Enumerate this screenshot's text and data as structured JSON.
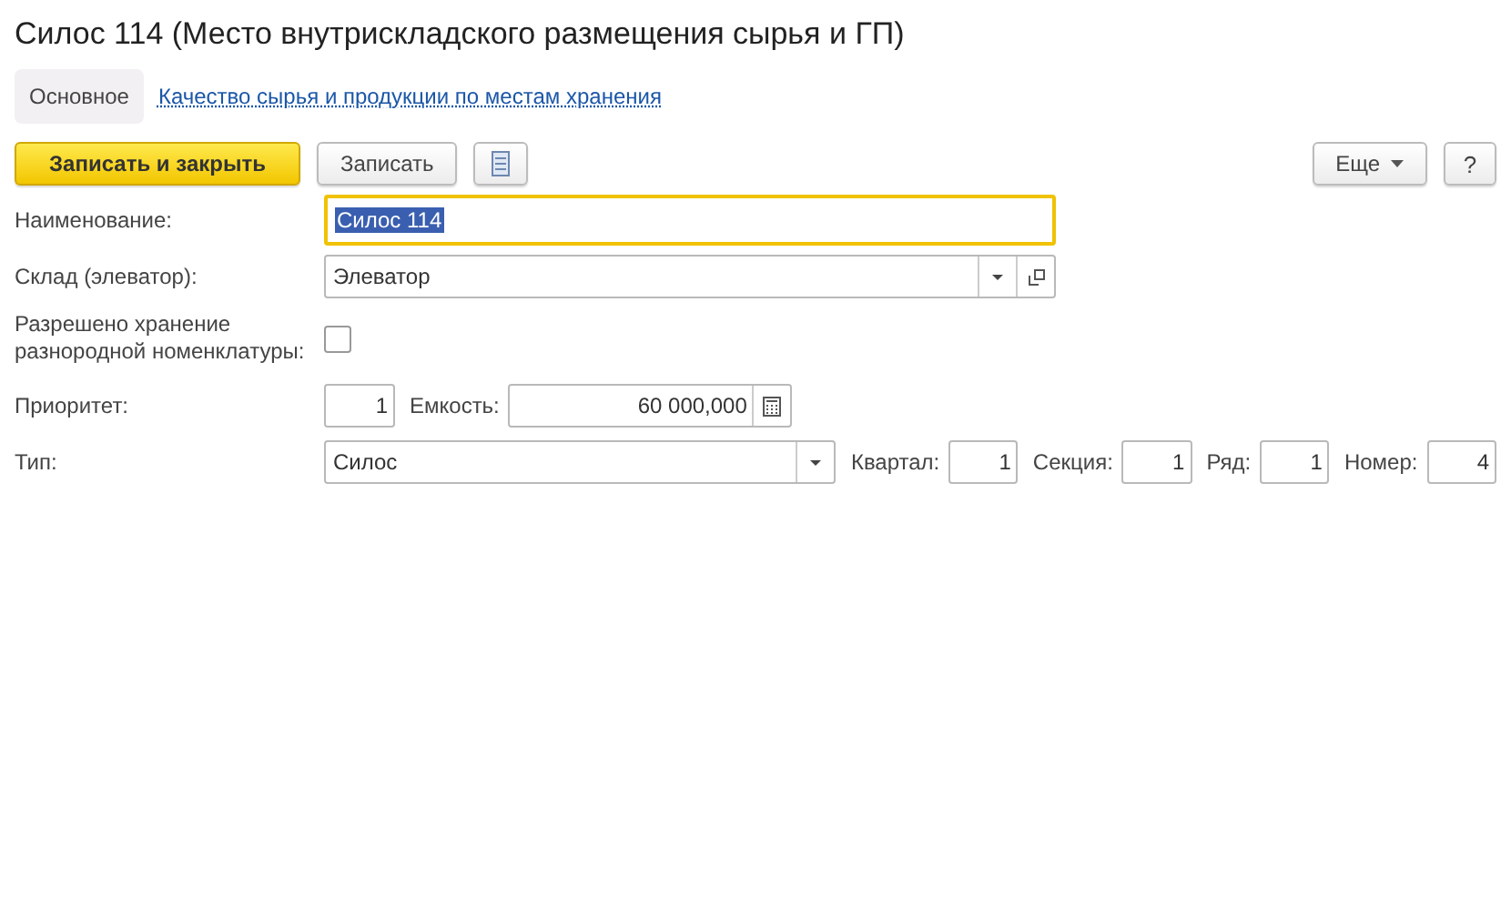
{
  "window": {
    "title": "Силос 114 (Место внутрискладского размещения сырья и ГП)"
  },
  "tabs": [
    {
      "label": "Основное",
      "selected": true
    },
    {
      "label": "Качество сырья и продукции по местам хранения",
      "selected": false
    }
  ],
  "toolbar": {
    "primary": "Записать и закрыть",
    "secondary": "Записать",
    "more": "Еще",
    "help": "?"
  },
  "fields": {
    "name": {
      "label": "Наименование:",
      "value": "Силос 114",
      "focused": true
    },
    "warehouse": {
      "label": "Склад (элеватор):",
      "value": "Элеватор"
    },
    "mixed": {
      "label": "Разрешено хранение разнородной номенклатуры:",
      "checked": false
    },
    "priority": {
      "label": "Приоритет:",
      "value": "1"
    },
    "capacity": {
      "label": "Емкость:",
      "value": "60 000,000"
    },
    "type": {
      "label": "Тип:",
      "value": "Силос"
    },
    "numbers": [
      {
        "label": "Квартал:",
        "value": "1"
      },
      {
        "label": "Секция:",
        "value": "1"
      },
      {
        "label": "Ряд:",
        "value": "1"
      },
      {
        "label": "Номер:",
        "value": "4"
      }
    ]
  }
}
